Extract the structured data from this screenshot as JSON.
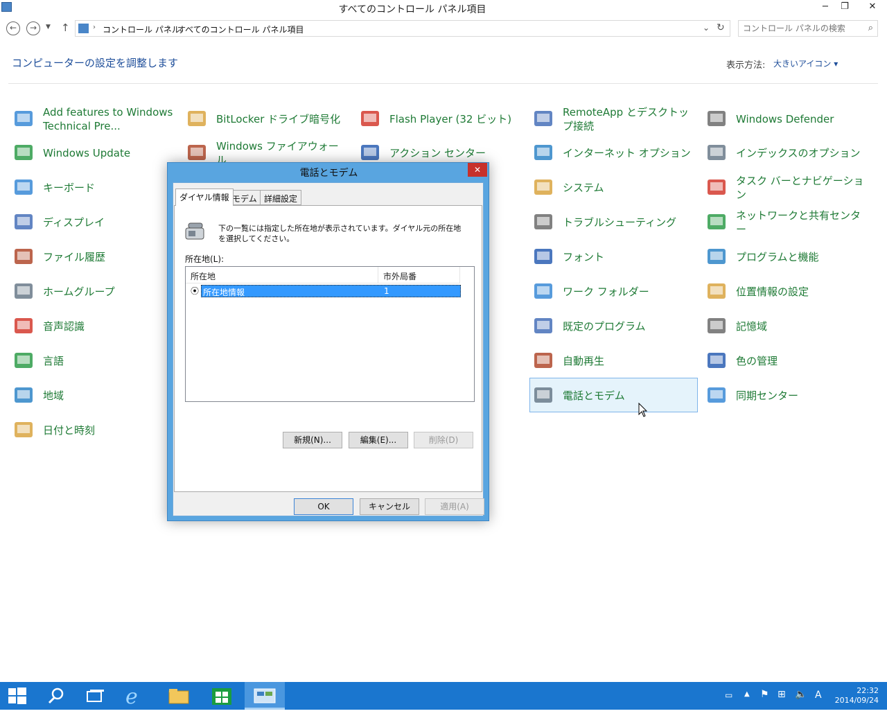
{
  "window": {
    "title": "すべてのコントロール パネル項目",
    "minimize": "−",
    "restore": "❐",
    "close": "✕"
  },
  "address": {
    "crumbs": [
      "コントロール パネル",
      "すべてのコントロール パネル項目"
    ],
    "search_placeholder": "コントロール パネルの検索"
  },
  "header": {
    "title": "コンピューターの設定を調整します",
    "view_by_label": "表示方法:",
    "view_by_value": "大きいアイコン ▾"
  },
  "items": [
    {
      "label": "Add features to Windows Technical Pre...",
      "icon": "add-features-icon"
    },
    {
      "label": "BitLocker ドライブ暗号化",
      "icon": "bitlocker-icon"
    },
    {
      "label": "Flash Player (32 ビット)",
      "icon": "flash-icon"
    },
    {
      "label": "RemoteApp とデスクトップ接続",
      "icon": "remoteapp-icon"
    },
    {
      "label": "Windows Defender",
      "icon": "defender-icon"
    },
    {
      "label": "Windows Update",
      "icon": "windows-update-icon"
    },
    {
      "label": "Windows ファイアウォール",
      "icon": "firewall-icon"
    },
    {
      "label": "アクション センター",
      "icon": "action-center-icon"
    },
    {
      "label": "インターネット オプション",
      "icon": "internet-options-icon"
    },
    {
      "label": "インデックスのオプション",
      "icon": "indexing-icon"
    },
    {
      "label": "キーボード",
      "icon": "keyboard-icon"
    },
    {
      "label": "システム",
      "icon": "system-icon"
    },
    {
      "label": "タスク バーとナビゲーション",
      "icon": "taskbar-icon"
    },
    {
      "label": "ディスプレイ",
      "icon": "display-icon"
    },
    {
      "label": "トラブルシューティング",
      "icon": "troubleshooting-icon"
    },
    {
      "label": "ネットワークと共有センター",
      "icon": "network-icon"
    },
    {
      "label": "ファイル履歴",
      "icon": "file-history-icon"
    },
    {
      "label": "フォント",
      "icon": "fonts-icon"
    },
    {
      "label": "プログラムと機能",
      "icon": "programs-icon"
    },
    {
      "label": "ホームグループ",
      "icon": "homegroup-icon"
    },
    {
      "label": "ワーク フォルダー",
      "icon": "work-folders-icon"
    },
    {
      "label": "位置情報の設定",
      "icon": "location-icon"
    },
    {
      "label": "音声認識",
      "icon": "speech-icon"
    },
    {
      "label": "既定のプログラム",
      "icon": "default-programs-icon"
    },
    {
      "label": "記憶域",
      "icon": "storage-icon"
    },
    {
      "label": "言語",
      "icon": "language-icon"
    },
    {
      "label": "自動再生",
      "icon": "autoplay-icon"
    },
    {
      "label": "色の管理",
      "icon": "color-management-icon"
    },
    {
      "label": "地域",
      "icon": "region-icon"
    },
    {
      "label": "電話とモデム",
      "icon": "phone-modem-icon"
    },
    {
      "label": "同期センター",
      "icon": "sync-center-icon"
    },
    {
      "label": "日付と時刻",
      "icon": "date-time-icon"
    }
  ],
  "dialog": {
    "title": "電話とモデム",
    "close": "✕",
    "tabs": [
      "ダイヤル情報",
      "モデム",
      "詳細設定"
    ],
    "description": "下の一覧には指定した所在地が表示されています。ダイヤル元の所在地を選択してください。",
    "locations_label": "所在地(L):",
    "columns": [
      "所在地",
      "市外局番"
    ],
    "rows": [
      {
        "location": "所在地情報",
        "area_code": "1"
      }
    ],
    "buttons": {
      "new": "新規(N)...",
      "edit": "編集(E)...",
      "delete": "削除(D)",
      "ok": "OK",
      "cancel": "キャンセル",
      "apply": "適用(A)"
    }
  },
  "taskbar": {
    "clock_time": "22:32",
    "clock_date": "2014/09/24",
    "ime": "A"
  },
  "colors": {
    "accent": "#1a76cf",
    "link": "#1e7a35",
    "header": "#1e4e9a"
  }
}
